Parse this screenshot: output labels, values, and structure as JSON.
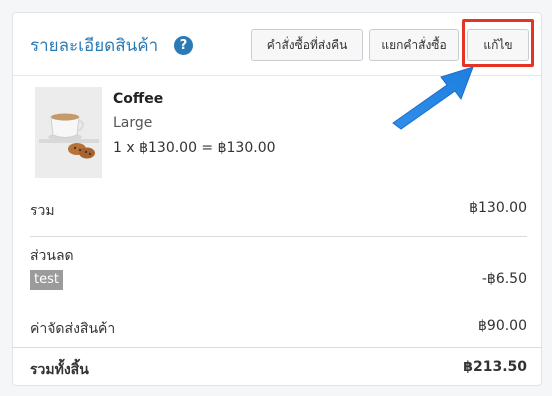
{
  "header": {
    "title": "รายละเอียดสินค้า",
    "help_icon": "?",
    "buttons": {
      "return_label": "คำสั่งซื้อที่ส่งคืน",
      "split_label": "แยกคำสั่งซื้อ",
      "edit_label": "แก้ไข"
    }
  },
  "product": {
    "name": "Coffee",
    "variant": "Large",
    "calc": "1 x ฿130.00 = ฿130.00",
    "image_icon": "coffee-cup-image"
  },
  "summary": {
    "subtotal_label": "รวม",
    "subtotal_value": "฿130.00",
    "discount_label": "ส่วนลด",
    "discount_code": "test",
    "discount_value": "-฿6.50",
    "shipping_label": "ค่าจัดส่งสินค้า",
    "shipping_value": "฿90.00",
    "total_label": "รวมทั้งสิ้น",
    "total_value": "฿213.50"
  },
  "colors": {
    "accent": "#2a7ab6",
    "highlight": "#e53423",
    "arrow": "#2f8ee8"
  }
}
